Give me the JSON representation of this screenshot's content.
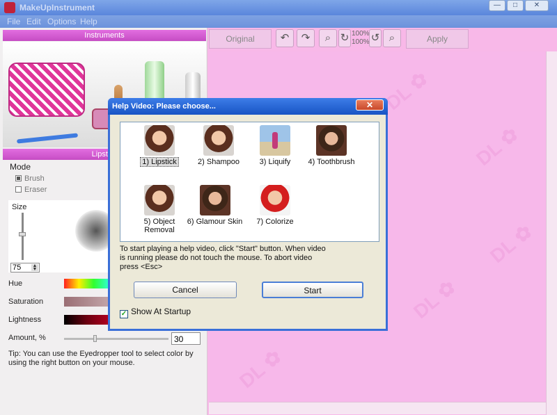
{
  "window": {
    "title": "MakeUpInstrument"
  },
  "menu": [
    "File",
    "Edit",
    "Options",
    "Help"
  ],
  "left_panel": {
    "instruments_header": "Instruments",
    "tool_header": "Lipstick",
    "mode_label": "Mode",
    "mode_options": [
      {
        "label": "Brush",
        "checked": true
      },
      {
        "label": "Eraser",
        "checked": false
      }
    ],
    "size_label": "Size",
    "size_value": "75",
    "hue_label": "Hue",
    "saturation_label": "Saturation",
    "lightness_label": "Lightness",
    "amount_label": "Amount, %",
    "amount_value": "30",
    "tip": "Tip: You can use the Eyedropper tool to select color by using the right button on your mouse."
  },
  "toolbar": {
    "original_label": "Original",
    "apply_label": "Apply",
    "zoom_top": "100%",
    "zoom_bottom": "100%"
  },
  "dialog": {
    "title": "Help Video: Please choose...",
    "close_label": "✕",
    "items": [
      {
        "label": "1) Lipstick",
        "selected": true
      },
      {
        "label": "2) Shampoo",
        "selected": false
      },
      {
        "label": "3) Liquify",
        "selected": false
      },
      {
        "label": "4) Toothbrush",
        "selected": false
      },
      {
        "label": "5) Object Removal",
        "selected": false
      },
      {
        "label": "6) Glamour Skin",
        "selected": false
      },
      {
        "label": "7) Colorize",
        "selected": false
      }
    ],
    "instructions": "To start playing a help video, click \"Start\" button. When video is running please do not touch the mouse. To abort video press <Esc>",
    "cancel_label": "Cancel",
    "start_label": "Start",
    "show_at_startup_label": "Show At Startup",
    "show_at_startup_checked": true
  }
}
